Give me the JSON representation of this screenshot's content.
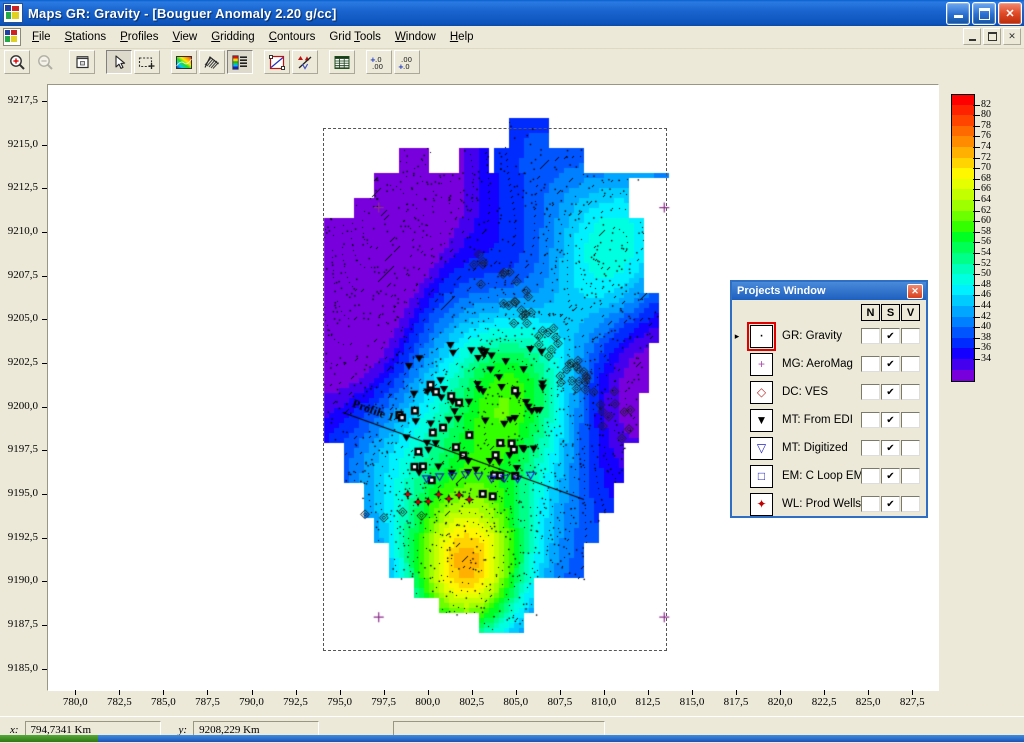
{
  "window": {
    "app_name": "Maps",
    "document_title": "GR: Gravity - [Bouguer Anomaly 2.20 g/cc]",
    "full_title": "Maps  GR: Gravity - [Bouguer Anomaly 2.20 g/cc]",
    "minimize_label": "_",
    "restore_label": "❐",
    "close_label": "✕",
    "app_icon_name": "maps-app-icon"
  },
  "mdi": {
    "minimize_label": "_",
    "restore_label": "❐",
    "close_label": "✕"
  },
  "menu": {
    "items": [
      {
        "label": "File",
        "accel": "F"
      },
      {
        "label": "Stations",
        "accel": "S"
      },
      {
        "label": "Profiles",
        "accel": "P"
      },
      {
        "label": "View",
        "accel": "V"
      },
      {
        "label": "Gridding",
        "accel": "G"
      },
      {
        "label": "Contours",
        "accel": "C"
      },
      {
        "label": "Grid Tools",
        "accel": "T"
      },
      {
        "label": "Window",
        "accel": "W"
      },
      {
        "label": "Help",
        "accel": "H"
      }
    ]
  },
  "toolbar": {
    "buttons": [
      {
        "name": "zoom-in-icon",
        "title": "Zoom In",
        "state": "enabled"
      },
      {
        "name": "zoom-out-icon",
        "title": "Zoom Out",
        "state": "disabled"
      },
      {
        "name": "zoom-extents-icon",
        "title": "Zoom Extents",
        "state": "enabled"
      },
      {
        "name": "pointer-select-icon",
        "title": "Select",
        "state": "pressed"
      },
      {
        "name": "rubber-band-select-icon",
        "title": "Rubber Band Select",
        "state": "enabled"
      },
      {
        "name": "color-fill-map-icon",
        "title": "Colour Fill",
        "state": "enabled"
      },
      {
        "name": "hatch-shading-icon",
        "title": "Shading",
        "state": "enabled"
      },
      {
        "name": "colour-scale-legend-icon",
        "title": "Colour Scale",
        "state": "pressed"
      },
      {
        "name": "grid-frame-icon",
        "title": "Grid Frame",
        "state": "enabled"
      },
      {
        "name": "statistics-icon",
        "title": "Statistics",
        "state": "enabled"
      },
      {
        "name": "data-table-icon",
        "title": "Data Table",
        "state": "enabled"
      },
      {
        "name": "increase-decimals-icon",
        "title": "Increase Decimals",
        "state": "enabled"
      },
      {
        "name": "decrease-decimals-icon",
        "title": "Decrease Decimals",
        "state": "enabled"
      }
    ]
  },
  "chart_data": {
    "type": "heatmap",
    "title": "Bouguer Anomaly 2.20 g/cc",
    "xlabel": "",
    "ylabel": "",
    "grid": false,
    "legend_position": "right",
    "xlim": [
      778.5,
      828.8
    ],
    "ylim": [
      9183.9,
      9218.4
    ],
    "x_ticks": [
      "780,0",
      "782,5",
      "785,0",
      "787,5",
      "790,0",
      "792,5",
      "795,0",
      "797,5",
      "800,0",
      "802,5",
      "805,0",
      "807,5",
      "810,0",
      "812,5",
      "815,0",
      "817,5",
      "820,0",
      "822,5",
      "825,0",
      "827,5"
    ],
    "y_ticks": [
      "9217,5",
      "9215,0",
      "9212,5",
      "9210,0",
      "9207,5",
      "9205,0",
      "9202,5",
      "9200,0",
      "9197,5",
      "9195,0",
      "9192,5",
      "9190,0",
      "9187,5",
      "9185,0"
    ],
    "colorbar": {
      "labels": [
        "82",
        "80",
        "78",
        "76",
        "74",
        "72",
        "70",
        "68",
        "66",
        "64",
        "62",
        "60",
        "58",
        "56",
        "54",
        "52",
        "50",
        "48",
        "46",
        "44",
        "42",
        "40",
        "38",
        "36",
        "34"
      ],
      "min": 34,
      "max": 84,
      "step": 2,
      "colors": [
        "#ff0000",
        "#ff2200",
        "#ff4400",
        "#ff6a00",
        "#ff8c00",
        "#ffb000",
        "#ffd400",
        "#fff700",
        "#e6ff00",
        "#c4ff00",
        "#9dff00",
        "#6bff00",
        "#33ff00",
        "#00ff22",
        "#00ff55",
        "#00ff88",
        "#00ffbb",
        "#00ffe0",
        "#00f0ff",
        "#00cbff",
        "#00a6ff",
        "#0080ff",
        "#0055ff",
        "#002bff",
        "#1400ff",
        "#4400ee",
        "#7700dd"
      ]
    },
    "annotations": [
      {
        "label": "Profile 1",
        "type": "profile-line"
      }
    ]
  },
  "projects_window": {
    "title": "Projects Window",
    "close_label": "✕",
    "columns": [
      "N",
      "S",
      "V"
    ],
    "selected_row": 0,
    "selection_marker": "▸",
    "check_glyph": "✔",
    "rows": [
      {
        "label": "GR: Gravity",
        "icon": "dot-marker-icon",
        "glyph": "·",
        "color": "#000000",
        "N": false,
        "S": true,
        "V": false
      },
      {
        "label": "MG: AeroMag",
        "icon": "plus-marker-icon",
        "glyph": "+",
        "color": "#b04ab0",
        "N": false,
        "S": true,
        "V": false
      },
      {
        "label": "DC: VES",
        "icon": "diamond-marker-icon",
        "glyph": "◇",
        "color": "#c03030",
        "N": false,
        "S": true,
        "V": false
      },
      {
        "label": "MT: From EDI",
        "icon": "filled-triangle-marker-icon",
        "glyph": "▼",
        "color": "#000000",
        "N": false,
        "S": true,
        "V": false
      },
      {
        "label": "MT: Digitized",
        "icon": "open-triangle-marker-icon",
        "glyph": "▽",
        "color": "#2020c0",
        "N": false,
        "S": true,
        "V": false
      },
      {
        "label": "EM: C Loop EM",
        "icon": "square-marker-icon",
        "glyph": "□",
        "color": "#2020c0",
        "N": false,
        "S": true,
        "V": false
      },
      {
        "label": "WL: Prod Wells",
        "icon": "well-marker-icon",
        "glyph": "✦",
        "color": "#c00000",
        "N": false,
        "S": true,
        "V": false
      }
    ]
  },
  "statusbar": {
    "x_label": "x:",
    "x_value": "794,7341 Km",
    "y_label": "y:",
    "y_value": "9208,229 Km",
    "message": ""
  }
}
